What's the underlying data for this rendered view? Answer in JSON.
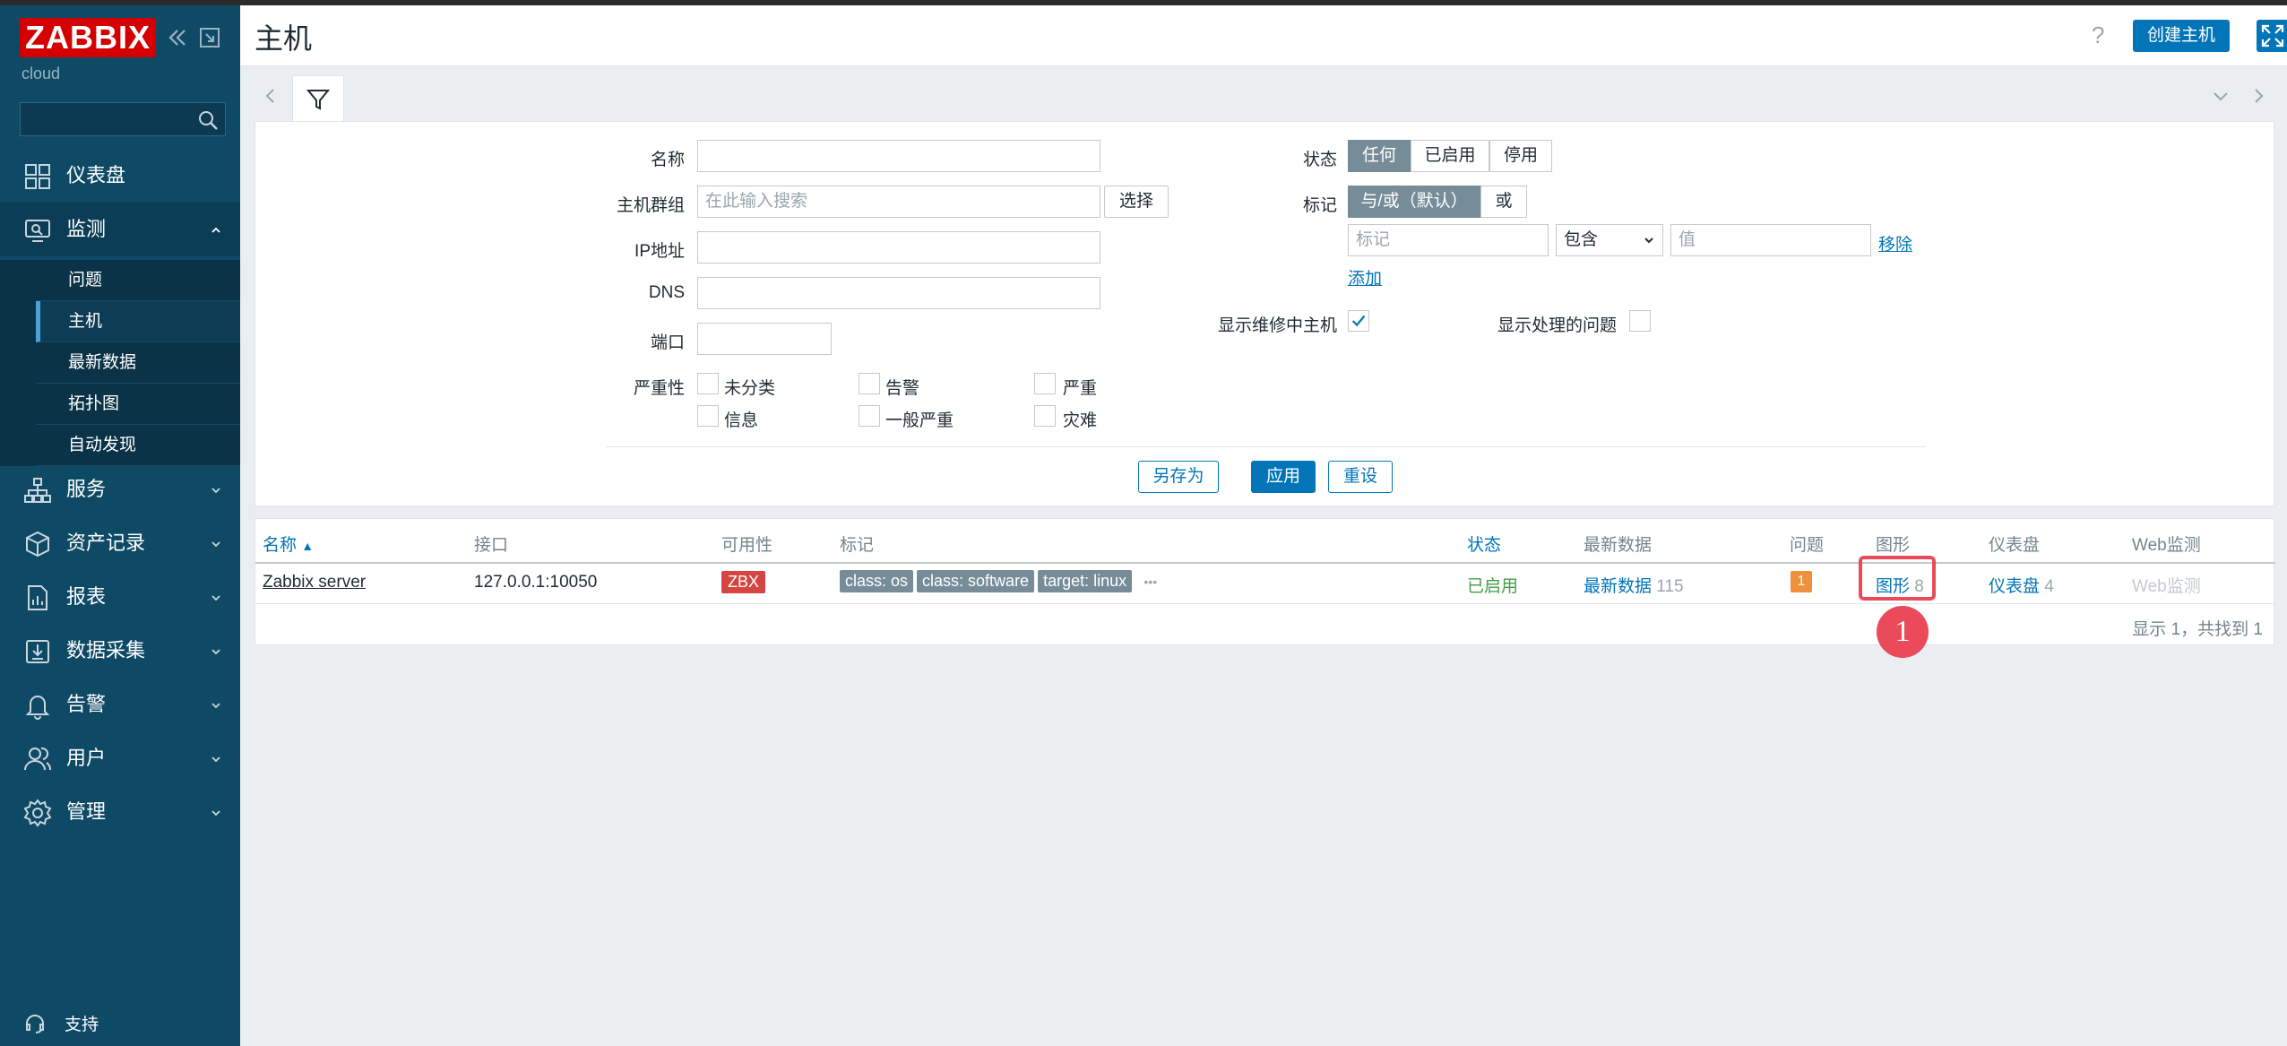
{
  "sidebar": {
    "logo": "ZABBIX",
    "instance": "cloud",
    "search_placeholder": "",
    "nav": [
      {
        "label": "仪表盘",
        "icon": "dashboard-icon"
      },
      {
        "label": "监测",
        "icon": "monitoring-icon"
      },
      {
        "label": "服务",
        "icon": "services-icon"
      },
      {
        "label": "资产记录",
        "icon": "inventory-icon"
      },
      {
        "label": "报表",
        "icon": "reports-icon"
      },
      {
        "label": "数据采集",
        "icon": "data-collection-icon"
      },
      {
        "label": "告警",
        "icon": "alerts-icon"
      },
      {
        "label": "用户",
        "icon": "users-icon"
      },
      {
        "label": "管理",
        "icon": "administration-icon"
      }
    ],
    "monitoring_sub": [
      "问题",
      "主机",
      "最新数据",
      "拓扑图",
      "自动发现"
    ],
    "support": "支持"
  },
  "header": {
    "title": "主机",
    "help": "?",
    "create_host": "创建主机"
  },
  "filter": {
    "name_label": "名称",
    "hostgroup_label": "主机群组",
    "hostgroup_placeholder": "在此输入搜索",
    "select_button": "选择",
    "ip_label": "IP地址",
    "dns_label": "DNS",
    "port_label": "端口",
    "severity_label": "严重性",
    "severities": [
      "未分类",
      "告警",
      "严重",
      "信息",
      "一般严重",
      "灾难"
    ],
    "status_label": "状态",
    "status_options": [
      "任何",
      "已启用",
      "停用"
    ],
    "tags_label": "标记",
    "tag_ops": [
      "与/或（默认）",
      "或"
    ],
    "tag_placeholder": "标记",
    "tag_operator": "包含",
    "value_placeholder": "值",
    "remove": "移除",
    "add": "添加",
    "show_maintenance": "显示维修中主机",
    "show_suppressed": "显示处理的问题",
    "save_as": "另存为",
    "apply": "应用",
    "reset": "重设"
  },
  "table": {
    "headers": [
      "名称",
      "接口",
      "可用性",
      "标记",
      "状态",
      "最新数据",
      "问题",
      "图形",
      "仪表盘",
      "Web监测"
    ],
    "sort_arrow": "▲",
    "row": {
      "name": "Zabbix server",
      "interface": "127.0.0.1:10050",
      "availability": "ZBX",
      "tags": [
        "class: os",
        "class: software",
        "target: linux"
      ],
      "more": "•••",
      "status": "已启用",
      "latest_data": "最新数据",
      "latest_count": "115",
      "problems": "1",
      "graphs": "图形",
      "graphs_count": "8",
      "dashboards": "仪表盘",
      "dashboards_count": "4",
      "web": "Web监测"
    },
    "footer": "显示 1，共找到 1"
  },
  "annotation": {
    "step": "1"
  },
  "colors": {
    "sidebar": "#0e4a66",
    "primary": "#0275b8",
    "logo": "#d40000",
    "highlight": "#ea4a5a"
  }
}
